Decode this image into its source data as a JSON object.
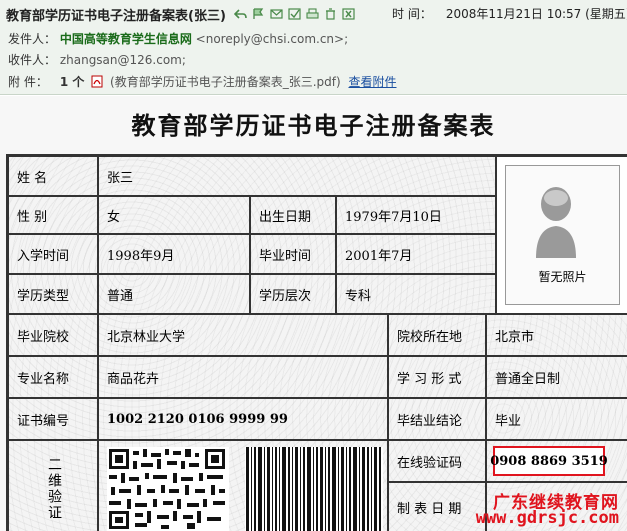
{
  "email": {
    "subject": "教育部学历证书电子注册备案表(张三)",
    "time_label": "时 间：",
    "time_value": "2008年11月21日 10:57 (星期五)",
    "from_label": "发件人：",
    "from_name": "中国高等教育学生信息网",
    "from_email": "<noreply@chsi.com.cn>;",
    "to_label": "收件人：",
    "to_email": "zhangsan@126.com;",
    "attach_label": "附  件：",
    "attach_count": "1 个",
    "attach_file": "(教育部学历证书电子注册备案表_张三.pdf)",
    "attach_view": "查看附件",
    "toolbar_icons": [
      "reply-icon",
      "flag-icon",
      "forward-icon",
      "move-icon",
      "print-icon",
      "delete-icon",
      "close-icon"
    ]
  },
  "document": {
    "title": "教育部学历证书电子注册备案表",
    "rows": {
      "name_label": "姓    名",
      "name_value": "张三",
      "gender_label": "性    别",
      "gender_value": "女",
      "birth_label": "出生日期",
      "birth_value": "1979年7月10日",
      "enroll_label": "入学时间",
      "enroll_value": "1998年9月",
      "grad_label": "毕业时间",
      "grad_value": "2001年7月",
      "edu_type_label": "学历类型",
      "edu_type_value": "普通",
      "edu_level_label": "学历层次",
      "edu_level_value": "专科",
      "school_label": "毕业院校",
      "school_value": "北京林业大学",
      "location_label": "院校所在地",
      "location_value": "北京市",
      "major_label": "专业名称",
      "major_value": "商品花卉",
      "study_form_label": "学 习 形 式",
      "study_form_value": "普通全日制",
      "cert_no_label": "证书编号",
      "cert_no_value": "1002 2120 0106 9999 99",
      "conclusion_label": "毕结业结论",
      "conclusion_value": "毕业",
      "qr_label": "二维验证",
      "verify_label": "在线验证码",
      "verify_value": "0908 8869 3519",
      "issue_label": "制 表 日 期"
    },
    "photo_caption": "暂无照片",
    "watermark_cn": "广东继续教育网",
    "watermark_url": "www.gdrsjc.com"
  }
}
